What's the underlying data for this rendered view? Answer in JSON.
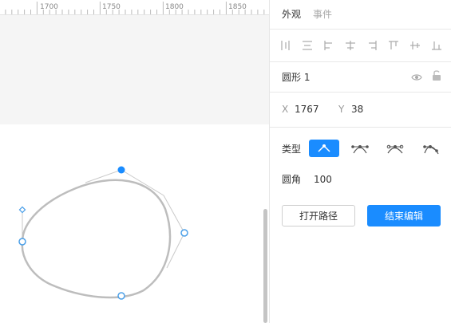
{
  "ruler": {
    "labels": [
      "1700",
      "1750",
      "1800",
      "1850"
    ]
  },
  "canvas": {
    "shape_stroke_color": "#bdbdbd",
    "handle_color": "#4a9fe8",
    "selected_point_color": "#1a8cff"
  },
  "panel": {
    "tabs": {
      "appearance": "外观",
      "events": "事件"
    },
    "align_tools": [
      "align-left-icon",
      "align-horizontal-center-icon",
      "align-right-icon",
      "distribute-horizontal-icon",
      "align-right-edge-icon",
      "align-top-icon",
      "align-vertical-center-icon",
      "align-bottom-icon"
    ],
    "layer_name": "圆形 1",
    "position": {
      "x_label": "X",
      "x_value": "1767",
      "y_label": "Y",
      "y_value": "38"
    },
    "point_type": {
      "label": "类型",
      "options": [
        "corner-point-icon",
        "mirrored-curve-icon",
        "asymmetric-curve-icon",
        "disconnected-curve-icon"
      ],
      "selected": 0
    },
    "corner_radius": {
      "label": "圆角",
      "value": "100"
    },
    "buttons": {
      "open_path": "打开路径",
      "end_edit": "结束编辑"
    },
    "accent_color": "#1a8cff"
  }
}
